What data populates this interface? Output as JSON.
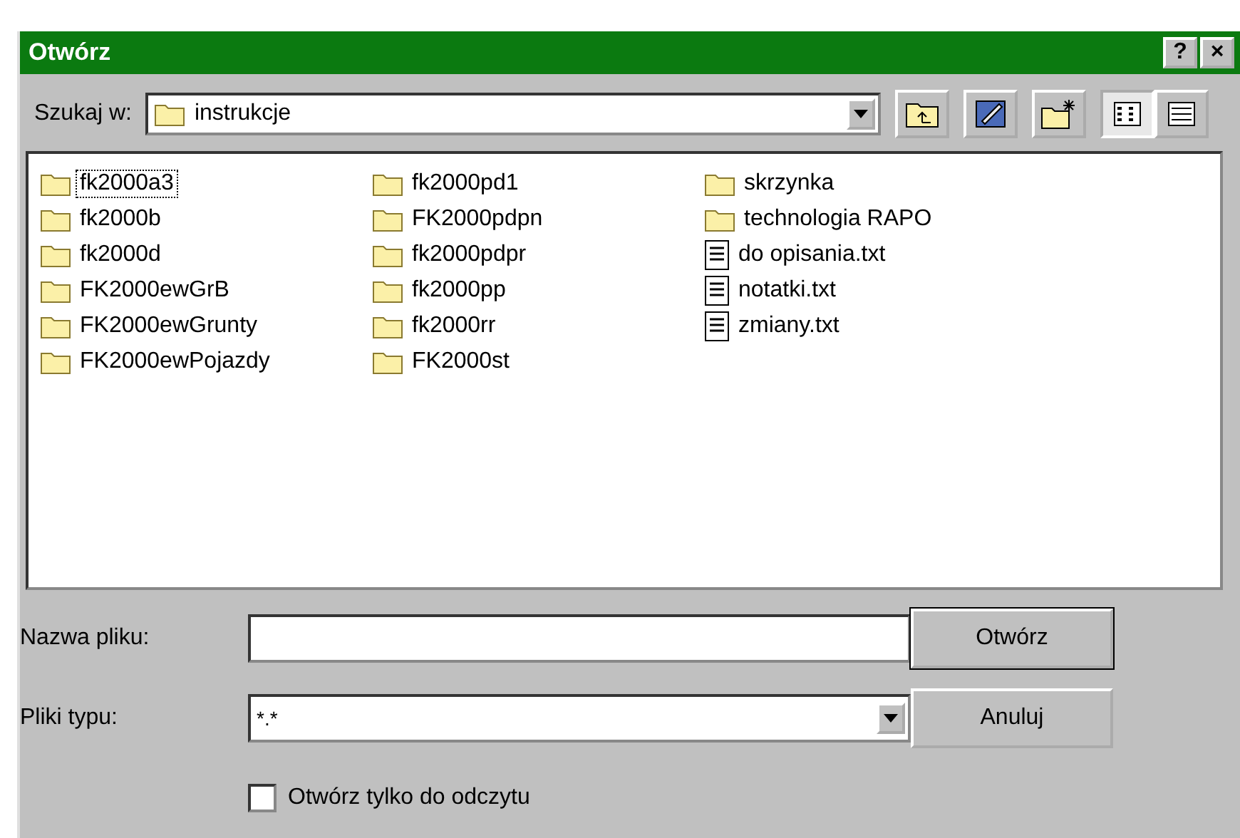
{
  "window": {
    "title": "Otwórz",
    "help_button": "?",
    "close_button": "×"
  },
  "look_in": {
    "label": "Szukaj w:",
    "value": "instrukcje"
  },
  "view_buttons": [
    {
      "kind": "list",
      "selected": true
    },
    {
      "kind": "details",
      "selected": false
    }
  ],
  "files": [
    {
      "name": "fk2000a3",
      "kind": "folder",
      "selected": true
    },
    {
      "name": "fk2000b",
      "kind": "folder",
      "selected": false
    },
    {
      "name": "fk2000d",
      "kind": "folder",
      "selected": false
    },
    {
      "name": "FK2000ewGrB",
      "kind": "folder",
      "selected": false
    },
    {
      "name": "FK2000ewGrunty",
      "kind": "folder",
      "selected": false
    },
    {
      "name": "FK2000ewPojazdy",
      "kind": "folder",
      "selected": false
    },
    {
      "name": "fk2000pd1",
      "kind": "folder",
      "selected": false
    },
    {
      "name": "FK2000pdpn",
      "kind": "folder",
      "selected": false
    },
    {
      "name": "fk2000pdpr",
      "kind": "folder",
      "selected": false
    },
    {
      "name": "fk2000pp",
      "kind": "folder",
      "selected": false
    },
    {
      "name": "fk2000rr",
      "kind": "folder",
      "selected": false
    },
    {
      "name": "FK2000st",
      "kind": "folder",
      "selected": false
    },
    {
      "name": "skrzynka",
      "kind": "folder",
      "selected": false
    },
    {
      "name": "technologia RAPO",
      "kind": "folder",
      "selected": false
    },
    {
      "name": "do opisania.txt",
      "kind": "text",
      "selected": false
    },
    {
      "name": "notatki.txt",
      "kind": "text",
      "selected": false
    },
    {
      "name": "zmiany.txt",
      "kind": "text",
      "selected": false
    }
  ],
  "file_name": {
    "label": "Nazwa pliku:"
  },
  "file_type": {
    "label": "Pliki typu:",
    "value": "*.*"
  },
  "read_only": {
    "label": "Otwórz tylko do odczytu",
    "checked": false
  },
  "buttons": [
    {
      "label": "Otwórz",
      "default": true
    },
    {
      "label": "Anuluj",
      "default": false
    }
  ]
}
